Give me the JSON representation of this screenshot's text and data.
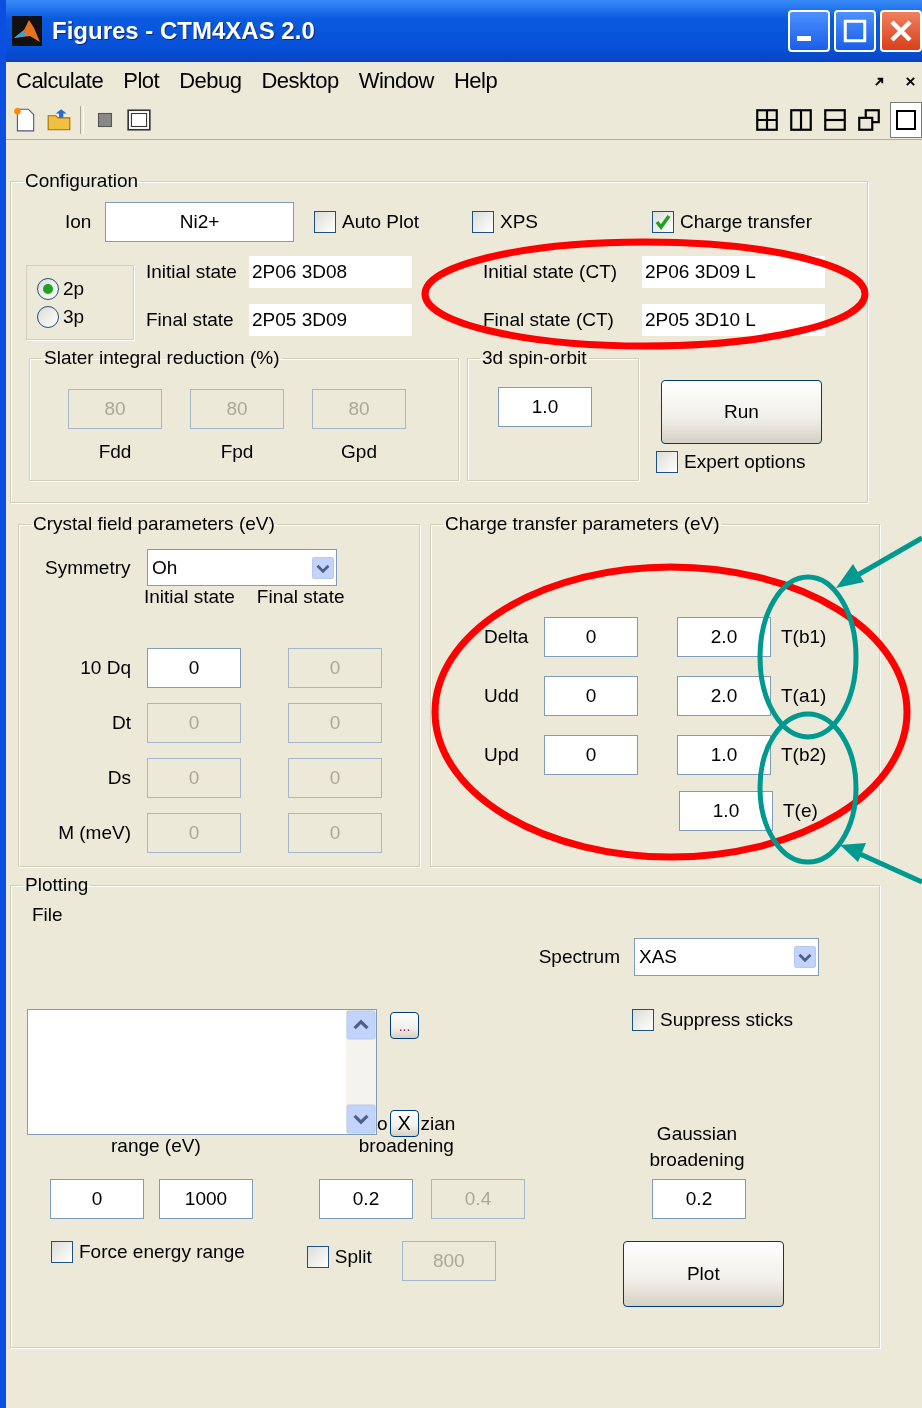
{
  "window": {
    "title": "Figures - CTM4XAS 2.0"
  },
  "menu": [
    {
      "label": "Calculate"
    },
    {
      "label": "Plot"
    },
    {
      "label": "Debug"
    },
    {
      "label": "Desktop"
    },
    {
      "label": "Window"
    },
    {
      "label": "Help"
    }
  ],
  "configuration": {
    "title": "Configuration",
    "ion": {
      "label": "Ion",
      "value": "Ni2+"
    },
    "options": [
      {
        "label": "Auto Plot",
        "checked": false
      },
      {
        "label": "XPS",
        "checked": false
      },
      {
        "label": "Charge transfer",
        "checked": true
      }
    ],
    "edge": [
      {
        "label": "2p",
        "selected": true
      },
      {
        "label": "3p",
        "selected": false
      }
    ],
    "states": [
      {
        "label": "Initial state",
        "value": "2P06 3D08"
      },
      {
        "label": "Final state",
        "value": "2P05 3D09"
      }
    ],
    "ct_states": [
      {
        "label": "Initial state (CT)",
        "value": "2P06 3D09 L"
      },
      {
        "label": "Final state (CT)",
        "value": "2P05 3D10 L"
      }
    ],
    "slater": {
      "title": "Slater integral reduction (%)",
      "fields": [
        {
          "label": "Fdd",
          "value": "80",
          "disabled": true
        },
        {
          "label": "Fpd",
          "value": "80",
          "disabled": true
        },
        {
          "label": "Gpd",
          "value": "80",
          "disabled": true
        }
      ]
    },
    "spin_orbit": {
      "title": "3d spin-orbit",
      "value": "1.0"
    },
    "run_button": "Run",
    "expert": {
      "label": "Expert options",
      "checked": false
    }
  },
  "crystal_field": {
    "title": "Crystal field parameters (eV)",
    "symmetry": {
      "label": "Symmetry",
      "value": "Oh"
    },
    "headers": [
      "Initial state",
      "Final state"
    ],
    "rows": [
      {
        "label": "10 Dq",
        "initial": {
          "value": "0",
          "disabled": false
        },
        "final": {
          "value": "0",
          "disabled": true
        }
      },
      {
        "label": "Dt",
        "initial": {
          "value": "0",
          "disabled": true
        },
        "final": {
          "value": "0",
          "disabled": true
        }
      },
      {
        "label": "Ds",
        "initial": {
          "value": "0",
          "disabled": true
        },
        "final": {
          "value": "0",
          "disabled": true
        }
      },
      {
        "label": "M (meV)",
        "initial": {
          "value": "0",
          "disabled": true
        },
        "final": {
          "value": "0",
          "disabled": true
        }
      }
    ]
  },
  "charge_transfer": {
    "title": "Charge transfer parameters (eV)",
    "rows": [
      {
        "label": "Delta",
        "value": "0",
        "hopping": "2.0",
        "hopping_label": "T(b1)"
      },
      {
        "label": "Udd",
        "value": "0",
        "hopping": "2.0",
        "hopping_label": "T(a1)"
      },
      {
        "label": "Upd",
        "value": "0",
        "hopping": "1.0",
        "hopping_label": "T(b2)"
      },
      {
        "hopping": "1.0",
        "hopping_label": "T(e)"
      }
    ]
  },
  "plotting": {
    "title": "Plotting",
    "file_label": "File",
    "spectrum": {
      "label": "Spectrum",
      "value": "XAS"
    },
    "browse_button": "...",
    "suppress_sticks": {
      "label": "Suppress sticks",
      "checked": false
    },
    "lorentzian_label_start": "o",
    "clear_button": "X",
    "lorentzian_label_end": "zian",
    "lorentzian_label_second": "broadening",
    "range_label": "range (eV)",
    "range": [
      "0",
      "1000"
    ],
    "lorentzian": [
      {
        "value": "0.2",
        "disabled": false
      },
      {
        "value": "0.4",
        "disabled": true
      }
    ],
    "gaussian": {
      "label": "Gaussian broadening",
      "value": "0.2"
    },
    "force_range": {
      "label": "Force energy range",
      "checked": false
    },
    "split": {
      "label": "Split",
      "checked": false,
      "value": "800",
      "disabled": true
    },
    "plot_button": "Plot"
  }
}
